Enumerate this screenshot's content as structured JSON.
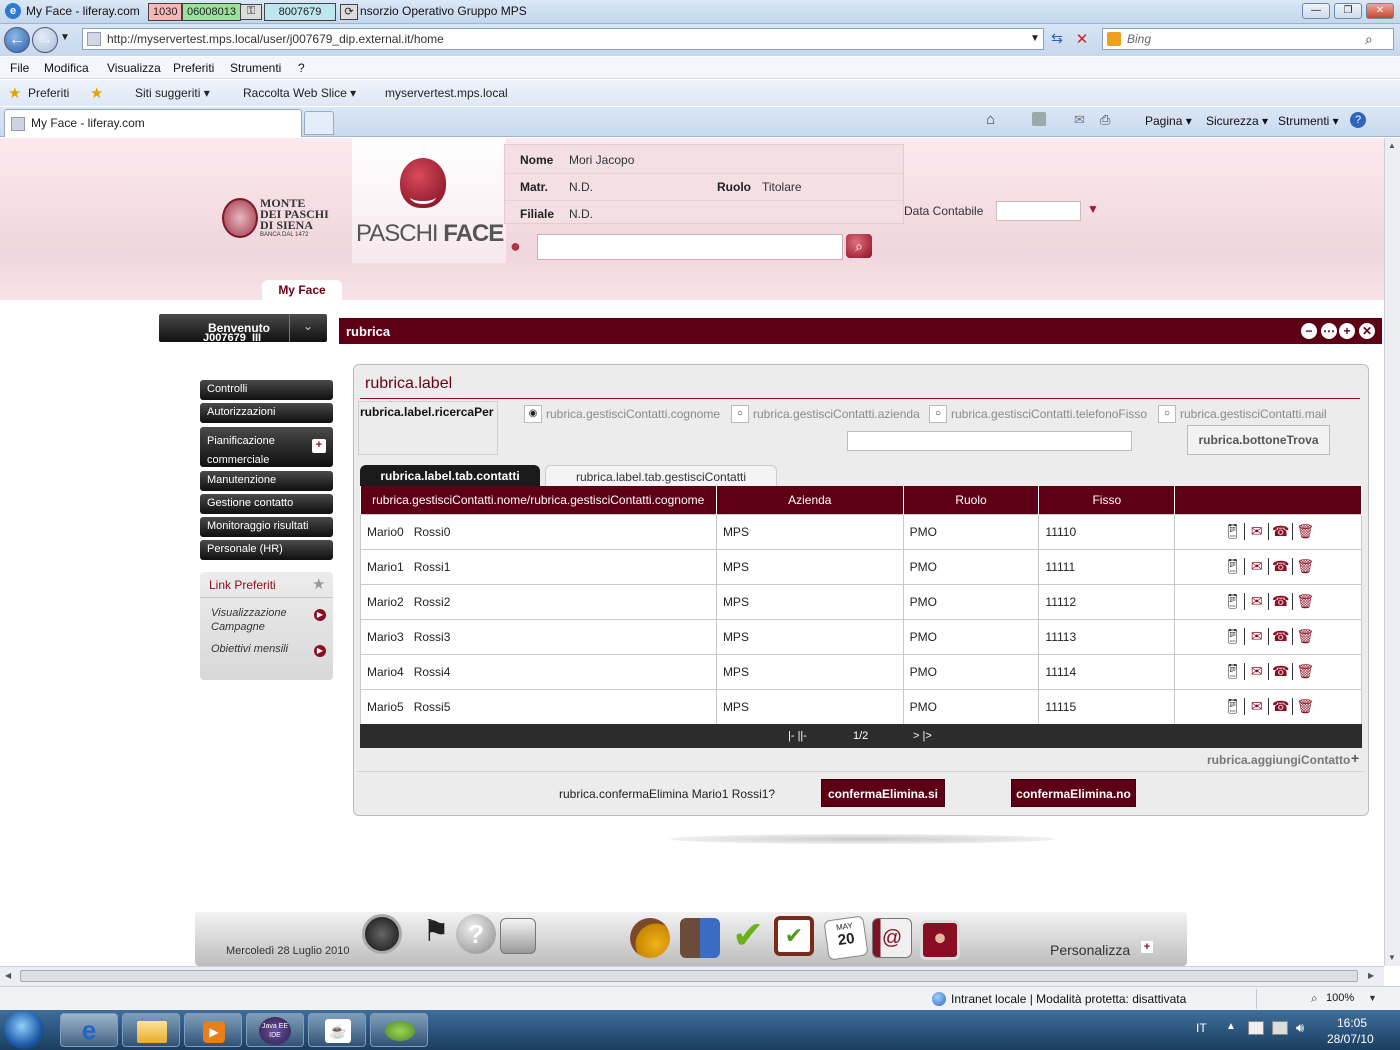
{
  "browser": {
    "title_prefix": "My Face - liferay.com",
    "title_suffix": "nsorzio Operativo Gruppo MPS",
    "title_boxes": [
      "1030",
      "06008013",
      "8007679"
    ],
    "address": "http://myservertest.mps.local/user/j007679_dip.external.it/home",
    "search_placeholder": "Bing",
    "menu": [
      "File",
      "Modifica",
      "Visualizza",
      "Preferiti",
      "Strumenti",
      "?"
    ],
    "favorites": {
      "label": "Preferiti",
      "items": [
        "Siti suggeriti ▾",
        "Raccolta Web Slice ▾",
        "myservertest.mps.local"
      ]
    },
    "tab_title": "My Face - liferay.com",
    "commands": [
      "Pagina ▾",
      "Sicurezza ▾",
      "Strumenti ▾"
    ],
    "status": "Intranet locale | Modalità protetta: disattivata",
    "zoom": "100%"
  },
  "header": {
    "logo_line1": "MONTE",
    "logo_line2": "DEI PASCHI",
    "logo_line3": "DI SIENA",
    "logo_line4": "BANCA DAL 1472",
    "app_name_1": "PASCHI",
    "app_name_2": "FACE",
    "nome_label": "Nome",
    "nome": "Mori Jacopo",
    "matr_label": "Matr.",
    "matr": "N.D.",
    "ruolo_label": "Ruolo",
    "ruolo": "Titolare",
    "filiale_label": "Filiale",
    "filiale": "N.D.",
    "data_contabile_label": "Data Contabile",
    "tab": "My Face"
  },
  "sidebar": {
    "welcome": "Benvenuto",
    "welcome_user": "J007679_III",
    "items": [
      "Controlli",
      "Autorizzazioni",
      "Pianificazione commerciale",
      "Manutenzione",
      "Gestione contatto",
      "Monitoraggio risultati",
      "Personale (HR)"
    ],
    "favorites_title": "Link Preferiti",
    "favorites": [
      "Visualizzazione Campagne",
      "Obiettivi mensili"
    ]
  },
  "portlet": {
    "title": "rubrica",
    "label": "rubrica.label",
    "search_by": "rubrica.label.ricercaPer",
    "radios": [
      "rubrica.gestisciContatti.cognome",
      "rubrica.gestisciContatti.azienda",
      "rubrica.gestisciContatti.telefonoFisso",
      "rubrica.gestisciContatti.mail"
    ],
    "selected_radio": "rubrica.gestisciContatti.cognome",
    "find_button": "rubrica.bottoneTrova",
    "tabs": [
      "rubrica.label.tab.contatti",
      "rubrica.label.tab.gestisciContatti"
    ],
    "columns": [
      "rubrica.gestisciContatti.nome/rubrica.gestisciContatti.cognome",
      "Azienda",
      "Ruolo",
      "Fisso"
    ],
    "rows": [
      {
        "nome": "Mario0",
        "cognome": "Rossi0",
        "azienda": "MPS",
        "ruolo": "PMO",
        "fisso": "11110"
      },
      {
        "nome": "Mario1",
        "cognome": "Rossi1",
        "azienda": "MPS",
        "ruolo": "PMO",
        "fisso": "11111"
      },
      {
        "nome": "Mario2",
        "cognome": "Rossi2",
        "azienda": "MPS",
        "ruolo": "PMO",
        "fisso": "11112"
      },
      {
        "nome": "Mario3",
        "cognome": "Rossi3",
        "azienda": "MPS",
        "ruolo": "PMO",
        "fisso": "11113"
      },
      {
        "nome": "Mario4",
        "cognome": "Rossi4",
        "azienda": "MPS",
        "ruolo": "PMO",
        "fisso": "11114"
      },
      {
        "nome": "Mario5",
        "cognome": "Rossi5",
        "azienda": "MPS",
        "ruolo": "PMO",
        "fisso": "11115"
      }
    ],
    "pager_first": "|- ||-",
    "page": "1/2",
    "pager_last": "> |>",
    "add_contact": "rubrica.aggiungiContatto",
    "confirm_question": "rubrica.confermaElimina Mario1 Rossi1?",
    "confirm_yes": "confermaElimina.si",
    "confirm_no": "confermaElimina.no"
  },
  "dock": {
    "date": "Mercoledì 28 Luglio 2010",
    "customize": "Personalizza",
    "calendar_month": "MAY",
    "calendar_day": "20"
  },
  "taskbar": {
    "lang": "IT",
    "time": "16:05",
    "date": "28/07/10",
    "java_label": "Java EE IDE"
  },
  "colors": {
    "brand": "#5e0015",
    "band": "#f3dfe4"
  }
}
